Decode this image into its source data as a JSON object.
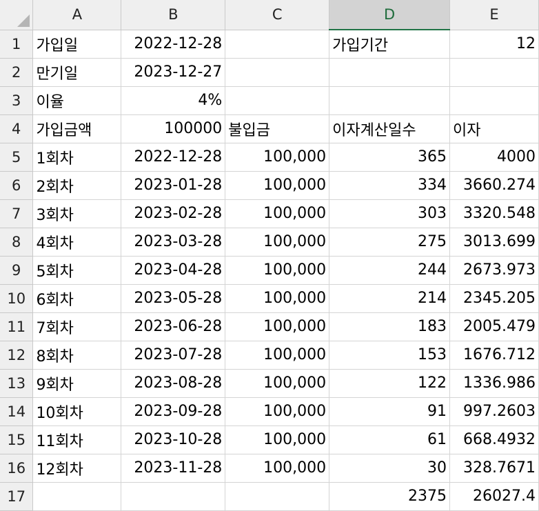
{
  "columns": [
    "A",
    "B",
    "C",
    "D",
    "E"
  ],
  "selected_column": "D",
  "rows": [
    {
      "n": "1",
      "cells": [
        "가입일",
        "2022-12-28",
        "",
        "가입기간",
        "12"
      ]
    },
    {
      "n": "2",
      "cells": [
        "만기일",
        "2023-12-27",
        "",
        "",
        ""
      ]
    },
    {
      "n": "3",
      "cells": [
        "이율",
        "4%",
        "",
        "",
        ""
      ]
    },
    {
      "n": "4",
      "cells": [
        "가입금액",
        "100000",
        "불입금",
        "이자계산일수",
        "이자"
      ]
    },
    {
      "n": "5",
      "cells": [
        "1회차",
        "2022-12-28",
        "100,000",
        "365",
        "4000"
      ]
    },
    {
      "n": "6",
      "cells": [
        "2회차",
        "2023-01-28",
        "100,000",
        "334",
        "3660.274"
      ]
    },
    {
      "n": "7",
      "cells": [
        "3회차",
        "2023-02-28",
        "100,000",
        "303",
        "3320.548"
      ]
    },
    {
      "n": "8",
      "cells": [
        "4회차",
        "2023-03-28",
        "100,000",
        "275",
        "3013.699"
      ]
    },
    {
      "n": "9",
      "cells": [
        "5회차",
        "2023-04-28",
        "100,000",
        "244",
        "2673.973"
      ]
    },
    {
      "n": "10",
      "cells": [
        "6회차",
        "2023-05-28",
        "100,000",
        "214",
        "2345.205"
      ]
    },
    {
      "n": "11",
      "cells": [
        "7회차",
        "2023-06-28",
        "100,000",
        "183",
        "2005.479"
      ]
    },
    {
      "n": "12",
      "cells": [
        "8회차",
        "2023-07-28",
        "100,000",
        "153",
        "1676.712"
      ]
    },
    {
      "n": "13",
      "cells": [
        "9회차",
        "2023-08-28",
        "100,000",
        "122",
        "1336.986"
      ]
    },
    {
      "n": "14",
      "cells": [
        "10회차",
        "2023-09-28",
        "100,000",
        "91",
        "997.2603"
      ]
    },
    {
      "n": "15",
      "cells": [
        "11회차",
        "2023-10-28",
        "100,000",
        "61",
        "668.4932"
      ]
    },
    {
      "n": "16",
      "cells": [
        "12회차",
        "2023-11-28",
        "100,000",
        "30",
        "328.7671"
      ]
    },
    {
      "n": "17",
      "cells": [
        "",
        "",
        "",
        "2375",
        "26027.4"
      ]
    }
  ]
}
